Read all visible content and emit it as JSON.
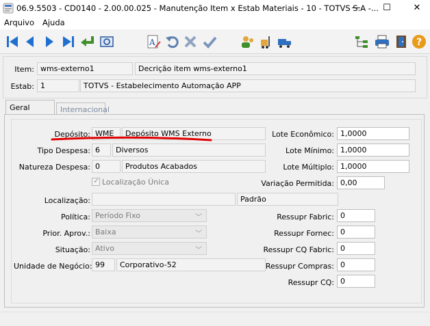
{
  "window": {
    "title": "06.9.5503 - CD0140 - 2.00.00.025 - Manutenção Item x Estab Materiais - 10 - TOTVS S.A -...",
    "minimize": "—",
    "maximize": "☐",
    "close": "✕"
  },
  "menu": {
    "file": "Arquivo",
    "help": "Ajuda"
  },
  "header": {
    "item_label": "Item:",
    "item_code": "wms-externo1",
    "item_desc": "Decrição item wms-externo1",
    "estab_label": "Estab:",
    "estab_code": "1",
    "estab_desc": "TOTVS - Estabelecimento Automação APP"
  },
  "tabs": {
    "general": "Geral",
    "international": "Internacional"
  },
  "form": {
    "deposito_label": "Depósito:",
    "deposito_code": "WME",
    "deposito_desc": "Depósito WMS Externo",
    "tipo_despesa_label": "Tipo Despesa:",
    "tipo_despesa_code": "6",
    "tipo_despesa_desc": "Diversos",
    "natureza_label": "Natureza Despesa:",
    "natureza_code": "0",
    "natureza_desc": "Produtos Acabados",
    "localizacao_unica_label": "Localização Única",
    "localizacao_label": "Localização:",
    "localizacao_value": "",
    "localizacao_padrao": "Padrão",
    "politica_label": "Política:",
    "politica_value": "Período Fixo",
    "prior_label": "Prior. Aprov.:",
    "prior_value": "Baixa",
    "situacao_label": "Situação:",
    "situacao_value": "Ativo",
    "unidade_label": "Unidade de Negócio:",
    "unidade_code": "99",
    "unidade_desc": "Corporativo-52",
    "lote_economico_label": "Lote Econômico:",
    "lote_economico_value": "1,0000",
    "lote_minimo_label": "Lote Mínimo:",
    "lote_minimo_value": "1,0000",
    "lote_multiplo_label": "Lote Múltiplo:",
    "lote_multiplo_value": "1,0000",
    "variacao_label": "Variação Permitida:",
    "variacao_value": "0,00",
    "ressupr_fabric_label": "Ressupr Fabric:",
    "ressupr_fabric_value": "0",
    "ressupr_fornec_label": "Ressupr Fornec:",
    "ressupr_fornec_value": "0",
    "ressupr_cq_fabric_label": "Ressupr CQ Fabric:",
    "ressupr_cq_fabric_value": "0",
    "ressupr_compras_label": "Ressupr Compras:",
    "ressupr_compras_value": "0",
    "ressupr_cq_label": "Ressupr CQ:",
    "ressupr_cq_value": "0"
  },
  "colors": {
    "toolbar_blue": "#1e6fd0",
    "toolbar_green": "#3f8f2a",
    "annotation_red": "#e00000"
  }
}
